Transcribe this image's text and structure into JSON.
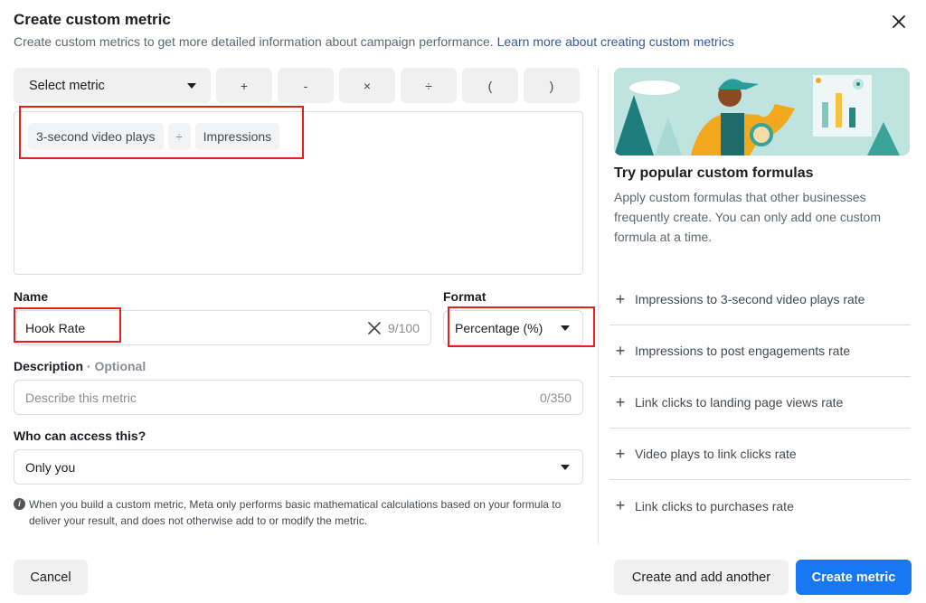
{
  "dialog": {
    "title": "Create custom metric",
    "subtitle": "Create custom metrics to get more detailed information about campaign performance.",
    "learn_more_link": "Learn more about creating custom metrics",
    "close_icon": "close-icon"
  },
  "toolbar": {
    "select_metric_label": "Select metric",
    "operators": [
      "+",
      "-",
      "×",
      "÷",
      "(",
      ")"
    ]
  },
  "formula": {
    "chips": [
      "3-second video plays",
      "÷",
      "Impressions"
    ]
  },
  "name_field": {
    "label": "Name",
    "value": "Hook Rate",
    "counter": "9/100",
    "clear_icon": "close-icon"
  },
  "format_field": {
    "label": "Format",
    "value": "Percentage (%)"
  },
  "description_field": {
    "label": "Description",
    "optional_label": "· Optional",
    "placeholder": "Describe this metric",
    "counter": "0/350"
  },
  "access_field": {
    "label": "Who can access this?",
    "value": "Only you"
  },
  "note": {
    "icon": "info-icon",
    "text": "When you build a custom metric, Meta only performs basic mathematical calculations based on your formula to deliver your result, and does not otherwise add to or modify the metric."
  },
  "sidebar": {
    "heading": "Try popular custom formulas",
    "description": "Apply custom formulas that other businesses frequently create. You can only add one custom formula at a time.",
    "formulas": [
      "Impressions to 3-second video plays rate",
      "Impressions to post engagements rate",
      "Link clicks to landing page views rate",
      "Video plays to link clicks rate",
      "Link clicks to purchases rate"
    ]
  },
  "footer": {
    "cancel_label": "Cancel",
    "create_another_label": "Create and add another",
    "create_label": "Create metric"
  },
  "colors": {
    "primary": "#1877f2",
    "link": "#385898",
    "highlight_box": "#e3201b"
  }
}
